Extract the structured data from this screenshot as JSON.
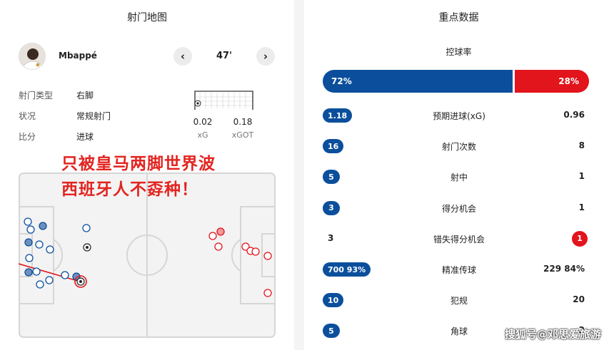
{
  "left": {
    "title": "射门地图",
    "player": {
      "name": "Mbappé",
      "minute": "47'"
    },
    "nav": {
      "prev": "‹",
      "next": "›"
    },
    "info": [
      {
        "label": "射门类型",
        "value": "右脚"
      },
      {
        "label": "状况",
        "value": "常规射门"
      },
      {
        "label": "比分",
        "value": "进球"
      }
    ],
    "xg": {
      "xg_value": "0.02",
      "xg_label": "xG",
      "xgot_value": "0.18",
      "xgot_label": "xGOT"
    },
    "overlay": {
      "line1": "只被皇马两脚世界波",
      "line2": "西班牙人不孬种！"
    }
  },
  "right": {
    "title": "重点数据",
    "possession": {
      "label": "控球率",
      "home": "72%",
      "away": "28%",
      "home_pct": 72
    },
    "stats": [
      {
        "home": "1.18",
        "label": "预期进球(xG)",
        "away": "0.96",
        "home_style": "pill",
        "away_style": "plain"
      },
      {
        "home": "16",
        "label": "射门次数",
        "away": "8",
        "home_style": "pill",
        "away_style": "plain"
      },
      {
        "home": "5",
        "label": "射中",
        "away": "1",
        "home_style": "pill",
        "away_style": "plain"
      },
      {
        "home": "3",
        "label": "得分机会",
        "away": "1",
        "home_style": "pill",
        "away_style": "plain"
      },
      {
        "home": "3",
        "label": "错失得分机会",
        "away": "1",
        "home_style": "plain",
        "away_style": "badge"
      },
      {
        "home": "700 93%",
        "label": "精准传球",
        "away": "229 84%",
        "home_style": "pill",
        "away_style": "plain"
      },
      {
        "home": "10",
        "label": "犯规",
        "away": "20",
        "home_style": "pill",
        "away_style": "plain"
      },
      {
        "home": "5",
        "label": "角球",
        "away": "2",
        "home_style": "pill",
        "away_style": "plain"
      }
    ]
  },
  "watermark": "搜狐号@邓思爱旅游",
  "colors": {
    "home": "#0b4f9c",
    "away": "#e2141c",
    "overlay": "#e32420"
  },
  "icons": {
    "prev": "chevron-left-icon",
    "next": "chevron-right-icon",
    "ball": "ball-icon",
    "goal": "goal-icon"
  }
}
